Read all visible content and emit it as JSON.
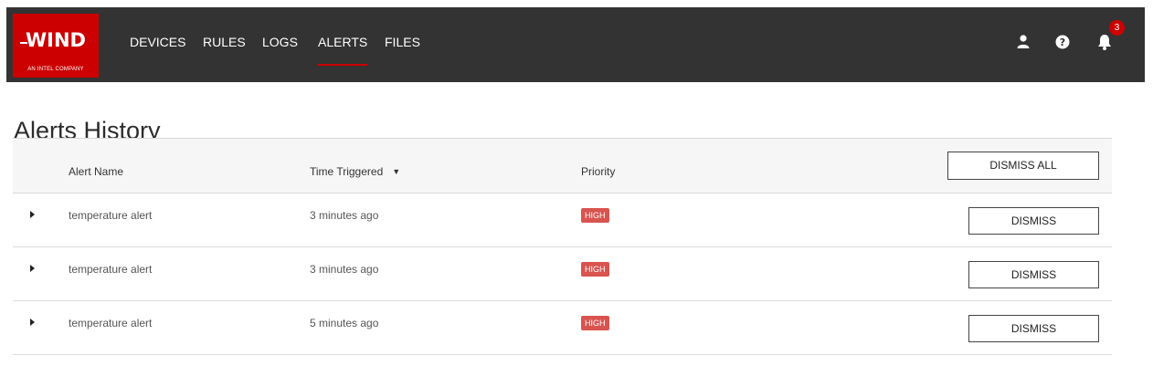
{
  "brand": {
    "logo_text": "WIND",
    "tagline": "AN INTEL COMPANY"
  },
  "nav": {
    "items": [
      {
        "label": "DEVICES"
      },
      {
        "label": "RULES"
      },
      {
        "label": "LOGS"
      },
      {
        "label": "ALERTS",
        "active": true
      },
      {
        "label": "FILES"
      }
    ]
  },
  "header_icons": [
    "user-icon",
    "help-icon",
    "bell-icon"
  ],
  "notifications": {
    "count": "3"
  },
  "page": {
    "title": "Alerts History"
  },
  "table": {
    "columns": {
      "name": "Alert Name",
      "time": "Time Triggered",
      "priority": "Priority"
    },
    "sort_column": "Time Triggered",
    "dismiss_all_label": "DISMISS ALL",
    "rows": [
      {
        "name": "temperature alert",
        "time": "3 minutes ago",
        "priority": "HIGH",
        "action": "DISMISS"
      },
      {
        "name": "temperature alert",
        "time": "3 minutes ago",
        "priority": "HIGH",
        "action": "DISMISS"
      },
      {
        "name": "temperature alert",
        "time": "5 minutes ago",
        "priority": "HIGH",
        "action": "DISMISS"
      }
    ]
  },
  "colors": {
    "accent": "#cc0000",
    "topbar": "#333333",
    "priority_high": "#d9534f"
  }
}
